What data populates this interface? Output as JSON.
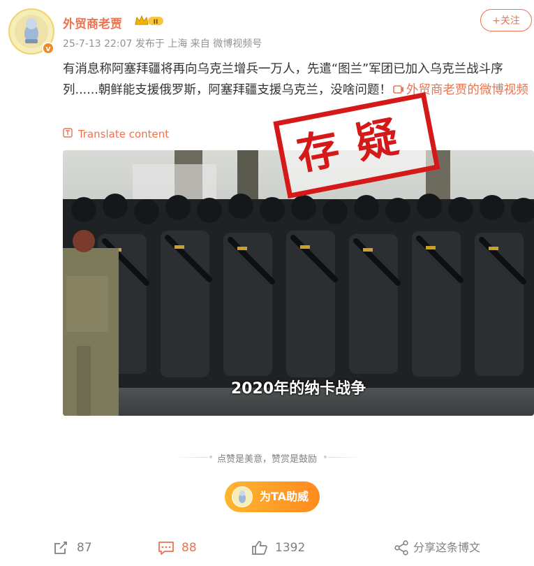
{
  "header": {
    "username": "外贸商老贾",
    "level_badge": "II",
    "meta": "25-7-13 22:07  发布于 上海  来自 微博视频号",
    "follow_label": "+关注",
    "verified_mark": "v"
  },
  "post": {
    "text_line": "有消息称阿塞拜疆将再向乌克兰增兵一万人，先遣“图兰”军团已加入乌克兰战斗序列......朝鲜能支援俄罗斯，阿塞拜疆支援乌克兰，没啥问题！",
    "video_link": "外贸商老贾的微博视频",
    "translate_label": "Translate content"
  },
  "media": {
    "caption": "2020年的纳卡战争",
    "stamp_text": "存疑"
  },
  "reward": {
    "text": "点赞是美意，赞赏是鼓励",
    "cheer_label": "为TA助威"
  },
  "actions": {
    "share_count": "87",
    "comment_count": "88",
    "like_count": "1392",
    "share_post_label": "分享这条博文"
  },
  "colors": {
    "accent": "#eb7350",
    "stamp": "#d51919",
    "cheer_gradient": [
      "#ffb52f",
      "#ff8a1f"
    ]
  },
  "icons": [
    "avatar-image",
    "crown-icon",
    "translate-icon",
    "video-link-icon",
    "repost-icon",
    "comment-icon",
    "like-icon",
    "share-icon"
  ]
}
